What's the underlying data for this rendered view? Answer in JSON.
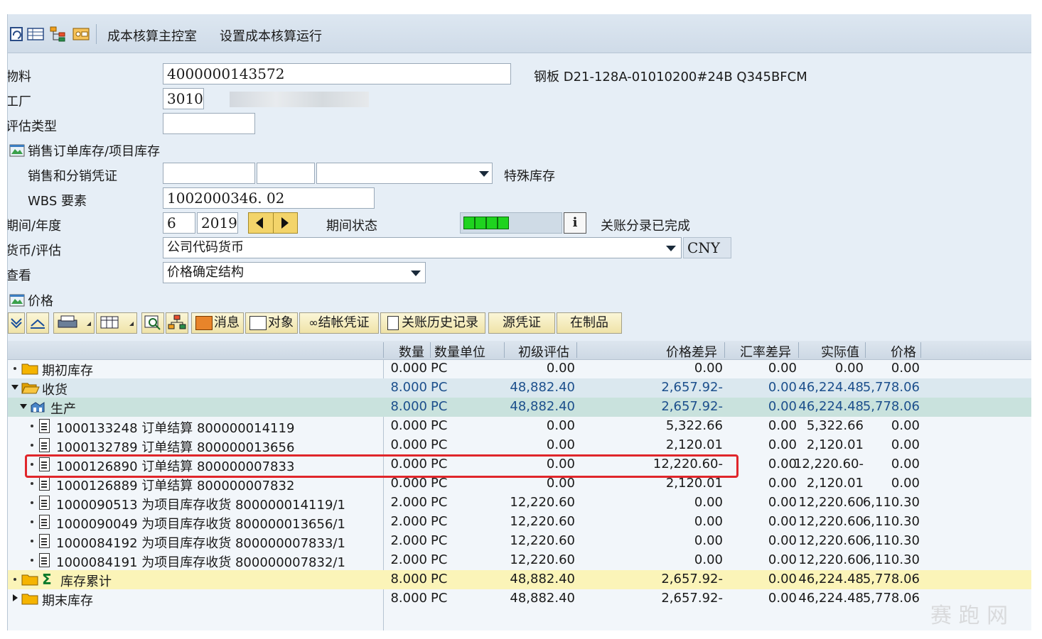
{
  "toolbar": {
    "menu1": "成本核算主控室",
    "menu2": "设置成本核算运行"
  },
  "form": {
    "material_label": "物料",
    "material_value": "4000000143572",
    "material_desc": "钢板 D21-128A-01010200#24B Q345BFCM",
    "plant_label": "工厂",
    "plant_value": "3010",
    "valuation_type_label": "评估类型",
    "valuation_type_value": "",
    "sales_project_label": "销售订单库存/项目库存",
    "sd_doc_label": "销售和分销凭证",
    "special_stock_label": "特殊库存",
    "wbs_label": "WBS 要素",
    "wbs_value": "1002000346. 02",
    "period_label": "期间/年度",
    "period_value": "6",
    "year_value": "2019",
    "period_status_label": "期间状态",
    "period_status_text": "关账分录已完成",
    "currency_label": "货币/评估",
    "currency_value": "公司代码货币",
    "currency_code": "CNY",
    "view_label": "查看",
    "view_value": "价格确定结构",
    "price_label": "价格"
  },
  "buttons": {
    "messages": "消息",
    "objects": "对象",
    "closing_doc": "结帐凭证",
    "closing_history": "关账历史记录",
    "source_doc": "源凭证",
    "wip": "在制品"
  },
  "grid": {
    "headers": {
      "qty": "数量",
      "unit": "数量单位",
      "initial": "初级评估",
      "price_diff": "价格差异",
      "fx_diff": "汇率差异",
      "actual": "实际值",
      "price": "价格"
    },
    "rows": [
      {
        "label": "期初库存",
        "qty": "0.000",
        "unit": "PC",
        "initial": "0.00",
        "pdiff": "0.00",
        "fx": "0.00",
        "actual": "0.00",
        "price": "0.00"
      },
      {
        "label": "收货",
        "qty": "8.000",
        "unit": "PC",
        "initial": "48,882.40",
        "pdiff": "2,657.92-",
        "fx": "0.00",
        "actual": "46,224.48",
        "price": "5,778.06"
      },
      {
        "label": "生产",
        "qty": "8.000",
        "unit": "PC",
        "initial": "48,882.40",
        "pdiff": "2,657.92-",
        "fx": "0.00",
        "actual": "46,224.48",
        "price": "5,778.06"
      },
      {
        "label": "1000133248 订单结算 800000014119",
        "qty": "0.000",
        "unit": "PC",
        "initial": "0.00",
        "pdiff": "5,322.66",
        "fx": "0.00",
        "actual": "5,322.66",
        "price": "0.00"
      },
      {
        "label": "1000132789 订单结算 800000013656",
        "qty": "0.000",
        "unit": "PC",
        "initial": "0.00",
        "pdiff": "2,120.01",
        "fx": "0.00",
        "actual": "2,120.01",
        "price": "0.00"
      },
      {
        "label": "1000126890 订单结算 800000007833",
        "qty": "0.000",
        "unit": "PC",
        "initial": "0.00",
        "pdiff": "12,220.60-",
        "fx": "0.00",
        "actual": "12,220.60-",
        "price": "0.00"
      },
      {
        "label": "1000126889 订单结算 800000007832",
        "qty": "0.000",
        "unit": "PC",
        "initial": "0.00",
        "pdiff": "2,120.01",
        "fx": "0.00",
        "actual": "2,120.01",
        "price": "0.00"
      },
      {
        "label": "1000090513 为项目库存收货 800000014119/1",
        "qty": "2.000",
        "unit": "PC",
        "initial": "12,220.60",
        "pdiff": "0.00",
        "fx": "0.00",
        "actual": "12,220.60",
        "price": "6,110.30"
      },
      {
        "label": "1000090049 为项目库存收货 800000013656/1",
        "qty": "2.000",
        "unit": "PC",
        "initial": "12,220.60",
        "pdiff": "0.00",
        "fx": "0.00",
        "actual": "12,220.60",
        "price": "6,110.30"
      },
      {
        "label": "1000084192 为项目库存收货 800000007833/1",
        "qty": "2.000",
        "unit": "PC",
        "initial": "12,220.60",
        "pdiff": "0.00",
        "fx": "0.00",
        "actual": "12,220.60",
        "price": "6,110.30"
      },
      {
        "label": "1000084191 为项目库存收货 800000007832/1",
        "qty": "2.000",
        "unit": "PC",
        "initial": "12,220.60",
        "pdiff": "0.00",
        "fx": "0.00",
        "actual": "12,220.60",
        "price": "6,110.30"
      },
      {
        "label": "库存累计",
        "qty": "8.000",
        "unit": "PC",
        "initial": "48,882.40",
        "pdiff": "2,657.92-",
        "fx": "0.00",
        "actual": "46,224.48",
        "price": "5,778.06"
      },
      {
        "label": "期末库存",
        "qty": "8.000",
        "unit": "PC",
        "initial": "48,882.40",
        "pdiff": "2,657.92-",
        "fx": "0.00",
        "actual": "46,224.48",
        "price": "5,778.06"
      }
    ]
  },
  "watermark": "赛 跑 网",
  "colors": {
    "highlight": "#e0262b",
    "value_blue": "#1c4f8c"
  }
}
